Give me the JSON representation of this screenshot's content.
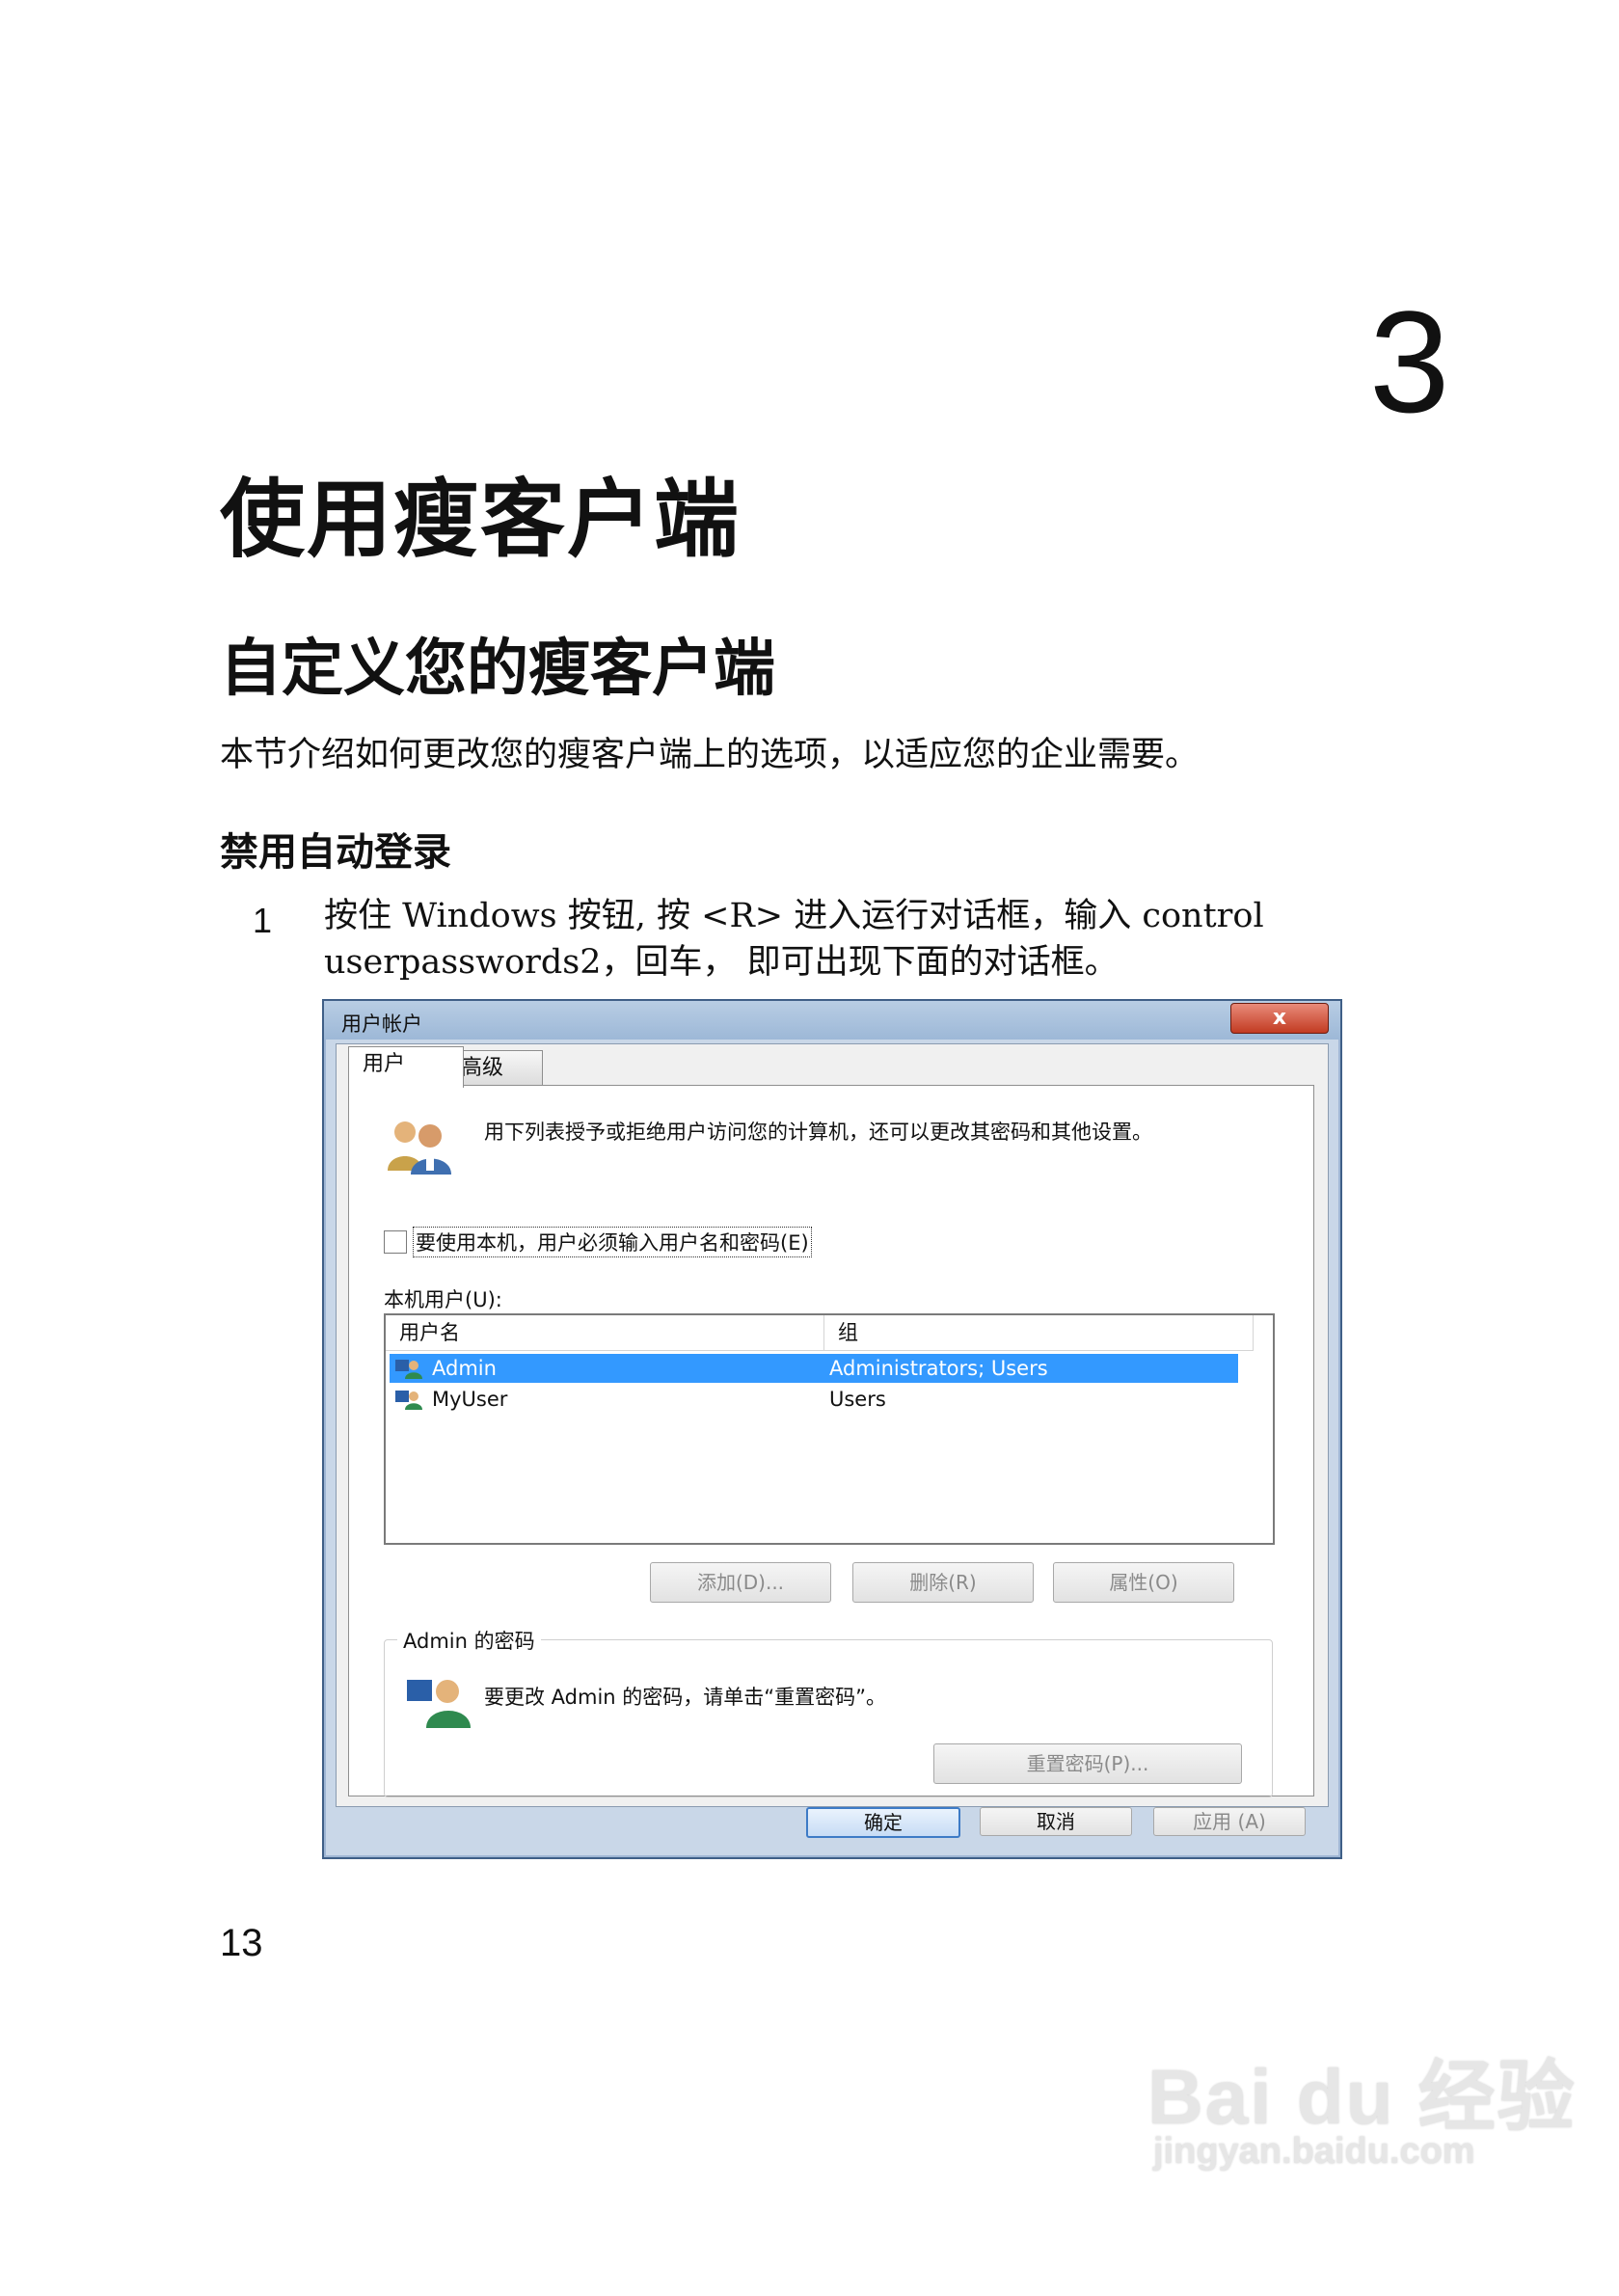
{
  "document": {
    "chapter_number": "3",
    "chapter_title": "使用瘦客户端",
    "section_title": "自定义您的瘦客户端",
    "intro": "本节介绍如何更改您的瘦客户端上的选项，以适应您的企业需要。",
    "subsection_title": "禁用自动登录",
    "step_number": "1",
    "step_line1": "按住 Windows 按钮, 按 <R> 进入运行对话框，输入 control",
    "step_line2": "userpasswords2，回车， 即可出现下面的对话框。",
    "page_number": "13"
  },
  "dialog": {
    "title": "用户帐户",
    "close_glyph": "x",
    "tabs": [
      {
        "label": "用户",
        "active": true
      },
      {
        "label": "高级",
        "active": false
      }
    ],
    "description": "用下列表授予或拒绝用户访问您的计算机，还可以更改其密码和其他设置。",
    "checkbox_label": "要使用本机，用户必须输入用户名和密码(E)",
    "checkbox_checked": false,
    "list_label": "本机用户(U):",
    "columns": [
      "用户名",
      "组"
    ],
    "rows": [
      {
        "name": "Admin",
        "group": "Administrators; Users",
        "selected": true
      },
      {
        "name": "MyUser",
        "group": "Users",
        "selected": false
      }
    ],
    "buttons": {
      "add": "添加(D)...",
      "remove": "删除(R)",
      "properties": "属性(O)"
    },
    "password_group_label": "Admin 的密码",
    "password_text": "要更改 Admin 的密码，请单击“重置密码”。",
    "reset_button": "重置密码(P)...",
    "ok": "确定",
    "cancel": "取消",
    "apply": "应用 (A)"
  },
  "watermark": {
    "logo": "Bai du 经验",
    "url": "jingyan.baidu.com"
  },
  "colors": {
    "selection": "#3399ff",
    "dialog_frame": "#c9d7e8",
    "close_button": "#c23b22"
  }
}
